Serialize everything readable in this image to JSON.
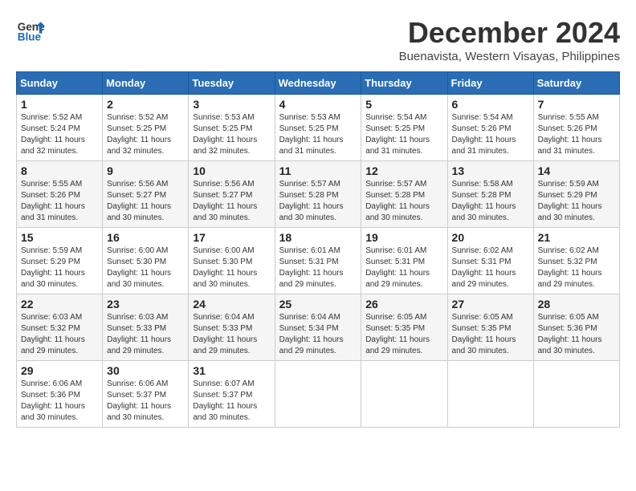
{
  "logo": {
    "line1": "General",
    "line2": "Blue"
  },
  "title": {
    "month_year": "December 2024",
    "location": "Buenavista, Western Visayas, Philippines"
  },
  "headers": [
    "Sunday",
    "Monday",
    "Tuesday",
    "Wednesday",
    "Thursday",
    "Friday",
    "Saturday"
  ],
  "weeks": [
    [
      {
        "day": "1",
        "sunrise": "5:52 AM",
        "sunset": "5:24 PM",
        "daylight": "11 hours and 32 minutes."
      },
      {
        "day": "2",
        "sunrise": "5:52 AM",
        "sunset": "5:25 PM",
        "daylight": "11 hours and 32 minutes."
      },
      {
        "day": "3",
        "sunrise": "5:53 AM",
        "sunset": "5:25 PM",
        "daylight": "11 hours and 32 minutes."
      },
      {
        "day": "4",
        "sunrise": "5:53 AM",
        "sunset": "5:25 PM",
        "daylight": "11 hours and 31 minutes."
      },
      {
        "day": "5",
        "sunrise": "5:54 AM",
        "sunset": "5:25 PM",
        "daylight": "11 hours and 31 minutes."
      },
      {
        "day": "6",
        "sunrise": "5:54 AM",
        "sunset": "5:26 PM",
        "daylight": "11 hours and 31 minutes."
      },
      {
        "day": "7",
        "sunrise": "5:55 AM",
        "sunset": "5:26 PM",
        "daylight": "11 hours and 31 minutes."
      }
    ],
    [
      {
        "day": "8",
        "sunrise": "5:55 AM",
        "sunset": "5:26 PM",
        "daylight": "11 hours and 31 minutes."
      },
      {
        "day": "9",
        "sunrise": "5:56 AM",
        "sunset": "5:27 PM",
        "daylight": "11 hours and 30 minutes."
      },
      {
        "day": "10",
        "sunrise": "5:56 AM",
        "sunset": "5:27 PM",
        "daylight": "11 hours and 30 minutes."
      },
      {
        "day": "11",
        "sunrise": "5:57 AM",
        "sunset": "5:28 PM",
        "daylight": "11 hours and 30 minutes."
      },
      {
        "day": "12",
        "sunrise": "5:57 AM",
        "sunset": "5:28 PM",
        "daylight": "11 hours and 30 minutes."
      },
      {
        "day": "13",
        "sunrise": "5:58 AM",
        "sunset": "5:28 PM",
        "daylight": "11 hours and 30 minutes."
      },
      {
        "day": "14",
        "sunrise": "5:59 AM",
        "sunset": "5:29 PM",
        "daylight": "11 hours and 30 minutes."
      }
    ],
    [
      {
        "day": "15",
        "sunrise": "5:59 AM",
        "sunset": "5:29 PM",
        "daylight": "11 hours and 30 minutes."
      },
      {
        "day": "16",
        "sunrise": "6:00 AM",
        "sunset": "5:30 PM",
        "daylight": "11 hours and 30 minutes."
      },
      {
        "day": "17",
        "sunrise": "6:00 AM",
        "sunset": "5:30 PM",
        "daylight": "11 hours and 30 minutes."
      },
      {
        "day": "18",
        "sunrise": "6:01 AM",
        "sunset": "5:31 PM",
        "daylight": "11 hours and 29 minutes."
      },
      {
        "day": "19",
        "sunrise": "6:01 AM",
        "sunset": "5:31 PM",
        "daylight": "11 hours and 29 minutes."
      },
      {
        "day": "20",
        "sunrise": "6:02 AM",
        "sunset": "5:31 PM",
        "daylight": "11 hours and 29 minutes."
      },
      {
        "day": "21",
        "sunrise": "6:02 AM",
        "sunset": "5:32 PM",
        "daylight": "11 hours and 29 minutes."
      }
    ],
    [
      {
        "day": "22",
        "sunrise": "6:03 AM",
        "sunset": "5:32 PM",
        "daylight": "11 hours and 29 minutes."
      },
      {
        "day": "23",
        "sunrise": "6:03 AM",
        "sunset": "5:33 PM",
        "daylight": "11 hours and 29 minutes."
      },
      {
        "day": "24",
        "sunrise": "6:04 AM",
        "sunset": "5:33 PM",
        "daylight": "11 hours and 29 minutes."
      },
      {
        "day": "25",
        "sunrise": "6:04 AM",
        "sunset": "5:34 PM",
        "daylight": "11 hours and 29 minutes."
      },
      {
        "day": "26",
        "sunrise": "6:05 AM",
        "sunset": "5:35 PM",
        "daylight": "11 hours and 29 minutes."
      },
      {
        "day": "27",
        "sunrise": "6:05 AM",
        "sunset": "5:35 PM",
        "daylight": "11 hours and 30 minutes."
      },
      {
        "day": "28",
        "sunrise": "6:05 AM",
        "sunset": "5:36 PM",
        "daylight": "11 hours and 30 minutes."
      }
    ],
    [
      {
        "day": "29",
        "sunrise": "6:06 AM",
        "sunset": "5:36 PM",
        "daylight": "11 hours and 30 minutes."
      },
      {
        "day": "30",
        "sunrise": "6:06 AM",
        "sunset": "5:37 PM",
        "daylight": "11 hours and 30 minutes."
      },
      {
        "day": "31",
        "sunrise": "6:07 AM",
        "sunset": "5:37 PM",
        "daylight": "11 hours and 30 minutes."
      },
      null,
      null,
      null,
      null
    ]
  ],
  "labels": {
    "sunrise_prefix": "Sunrise: ",
    "sunset_prefix": "Sunset: ",
    "daylight_prefix": "Daylight: "
  }
}
